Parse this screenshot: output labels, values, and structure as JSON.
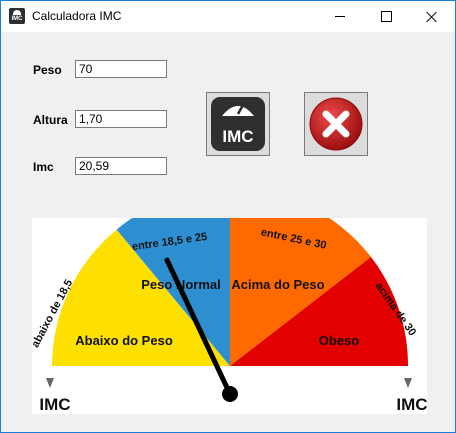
{
  "window": {
    "title": "Calculadora IMC",
    "app_icon": "imc-scale-icon",
    "controls": [
      "minimize-icon",
      "maximize-icon",
      "close-icon"
    ]
  },
  "form": {
    "peso_label": "Peso",
    "peso_value": "70",
    "altura_label": "Altura",
    "altura_value": "1,70",
    "imc_label": "Imc",
    "imc_value": "20,59"
  },
  "buttons": {
    "calculate_icon_text": "IMC",
    "calculate_icon": "scale-imc-icon",
    "clear_icon": "red-x-icon"
  },
  "gauge": {
    "segments": [
      {
        "label": "Abaixo do Peso",
        "range_label": "abaixo de 18,5",
        "color": "#fde000"
      },
      {
        "label": "Peso Normal",
        "range_label": "entre 18,5 e 25",
        "color": "#2e8fd0"
      },
      {
        "label": "Acima do Peso",
        "range_label": "entre 25 e 30",
        "color": "#ff6a00"
      },
      {
        "label": "Obeso",
        "range_label": "acima de 30",
        "color": "#e30000"
      }
    ],
    "left_axis_label": "IMC",
    "right_axis_label": "IMC",
    "needle_value": 20.59
  }
}
